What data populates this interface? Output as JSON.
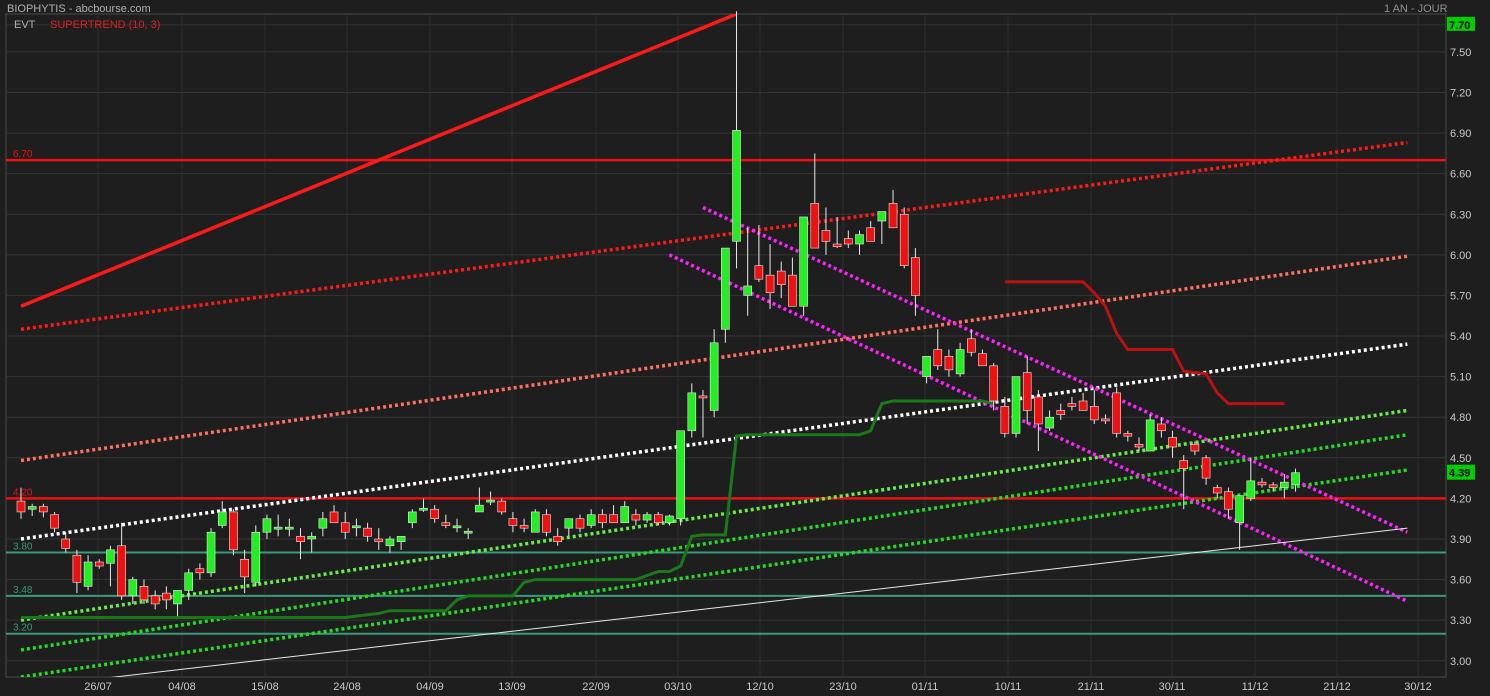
{
  "header": {
    "title": "BIOPHYTIS - abcbourse.com",
    "period": "1 AN - JOUR",
    "indicator_name": "EVT",
    "indicator_label": "SUPERTREND (10, 3)"
  },
  "chart_data": {
    "type": "candlestick",
    "ylim": [
      2.88,
      7.78
    ],
    "y_ticks": [
      "7.70",
      "7.50",
      "7.20",
      "6.90",
      "6.60",
      "6.30",
      "6.00",
      "5.70",
      "5.40",
      "5.10",
      "4.80",
      "4.50",
      "4.20",
      "3.90",
      "3.60",
      "3.30",
      "3.00"
    ],
    "x_labels": [
      "26/07",
      "04/08",
      "15/08",
      "24/08",
      "04/09",
      "13/09",
      "22/09",
      "03/10",
      "12/10",
      "23/10",
      "01/11",
      "10/11",
      "21/11",
      "30/11",
      "11/12",
      "21/12",
      "30/12"
    ],
    "last_price": "4.39",
    "horizontal_levels": [
      {
        "label": "6.70",
        "value": 6.7,
        "color": "#ee1111"
      },
      {
        "label": "4.20",
        "value": 4.2,
        "color": "#ee1111"
      },
      {
        "label": "3.80",
        "value": 3.8,
        "color": "#3a9a7a"
      },
      {
        "label": "3.48",
        "value": 3.48,
        "color": "#3a9a7a"
      },
      {
        "label": "3.20",
        "value": 3.2,
        "color": "#3a9a7a"
      }
    ],
    "candles": [
      [
        4.18,
        4.28,
        4.05,
        4.1
      ],
      [
        4.12,
        4.16,
        4.07,
        4.14
      ],
      [
        4.14,
        4.16,
        4.06,
        4.1
      ],
      [
        4.08,
        4.1,
        3.95,
        3.98
      ],
      [
        3.9,
        3.95,
        3.8,
        3.83
      ],
      [
        3.78,
        3.82,
        3.5,
        3.58
      ],
      [
        3.55,
        3.78,
        3.52,
        3.73
      ],
      [
        3.73,
        3.75,
        3.68,
        3.7
      ],
      [
        3.72,
        3.85,
        3.55,
        3.82
      ],
      [
        3.85,
        4.02,
        3.45,
        3.48
      ],
      [
        3.48,
        3.62,
        3.42,
        3.6
      ],
      [
        3.55,
        3.6,
        3.42,
        3.45
      ],
      [
        3.48,
        3.52,
        3.38,
        3.42
      ],
      [
        3.5,
        3.55,
        3.38,
        3.45
      ],
      [
        3.42,
        3.5,
        3.33,
        3.52
      ],
      [
        3.52,
        3.68,
        3.45,
        3.65
      ],
      [
        3.68,
        3.72,
        3.6,
        3.65
      ],
      [
        3.65,
        3.98,
        3.62,
        3.95
      ],
      [
        4.0,
        4.18,
        3.98,
        4.1
      ],
      [
        4.1,
        4.12,
        3.78,
        3.82
      ],
      [
        3.75,
        3.82,
        3.5,
        3.62
      ],
      [
        3.58,
        4.0,
        3.55,
        3.95
      ],
      [
        3.95,
        4.08,
        3.9,
        4.05
      ],
      [
        3.98,
        4.08,
        3.92,
        3.98
      ],
      [
        3.98,
        4.05,
        3.92,
        3.98
      ],
      [
        3.92,
        3.98,
        3.75,
        3.88
      ],
      [
        3.9,
        3.95,
        3.8,
        3.92
      ],
      [
        3.98,
        4.1,
        3.92,
        4.05
      ],
      [
        4.1,
        4.15,
        4.02,
        4.02
      ],
      [
        4.02,
        4.1,
        3.9,
        3.95
      ],
      [
        3.98,
        4.05,
        3.92,
        3.99
      ],
      [
        3.98,
        4.02,
        3.88,
        3.92
      ],
      [
        3.9,
        3.98,
        3.82,
        3.88
      ],
      [
        3.85,
        3.92,
        3.8,
        3.9
      ],
      [
        3.88,
        3.92,
        3.82,
        3.92
      ],
      [
        4.02,
        4.12,
        3.98,
        4.1
      ],
      [
        4.12,
        4.2,
        4.1,
        4.12
      ],
      [
        4.12,
        4.15,
        4.02,
        4.05
      ],
      [
        4.02,
        4.08,
        3.98,
        4.0
      ],
      [
        3.98,
        4.05,
        3.95,
        3.99
      ],
      [
        3.94,
        3.98,
        3.9,
        3.95
      ],
      [
        4.1,
        4.28,
        4.1,
        4.15
      ],
      [
        4.18,
        4.25,
        4.15,
        4.18
      ],
      [
        4.18,
        4.2,
        4.08,
        4.1
      ],
      [
        4.05,
        4.1,
        3.95,
        4.0
      ],
      [
        4.0,
        4.05,
        3.95,
        3.98
      ],
      [
        3.95,
        4.12,
        3.95,
        4.1
      ],
      [
        4.08,
        4.12,
        3.92,
        3.95
      ],
      [
        3.92,
        3.98,
        3.85,
        3.88
      ],
      [
        3.98,
        4.05,
        3.92,
        4.05
      ],
      [
        4.05,
        4.08,
        3.95,
        3.98
      ],
      [
        4.0,
        4.12,
        3.98,
        4.08
      ],
      [
        4.08,
        4.12,
        3.98,
        4.02
      ],
      [
        4.08,
        4.15,
        4.02,
        4.02
      ],
      [
        4.02,
        4.18,
        4.02,
        4.14
      ],
      [
        4.08,
        4.12,
        4.0,
        4.04
      ],
      [
        4.04,
        4.1,
        4.02,
        4.08
      ],
      [
        4.08,
        4.1,
        4.0,
        4.02
      ],
      [
        4.02,
        4.08,
        4.0,
        4.07
      ],
      [
        4.05,
        4.7,
        4.0,
        4.7
      ],
      [
        4.7,
        5.05,
        4.65,
        4.98
      ],
      [
        4.95,
        5.0,
        4.65,
        4.94
      ],
      [
        4.85,
        5.45,
        4.8,
        5.35
      ],
      [
        5.45,
        6.05,
        5.35,
        6.05
      ],
      [
        6.1,
        7.8,
        5.9,
        6.92
      ],
      [
        5.7,
        6.2,
        5.55,
        5.77
      ],
      [
        5.92,
        6.22,
        5.8,
        5.82
      ],
      [
        5.85,
        6.08,
        5.6,
        5.72
      ],
      [
        5.88,
        5.95,
        5.68,
        5.78
      ],
      [
        5.85,
        5.98,
        5.62,
        5.62
      ],
      [
        5.62,
        6.05,
        5.55,
        6.28
      ],
      [
        6.38,
        6.75,
        6.1,
        6.05
      ],
      [
        6.18,
        6.35,
        6.0,
        6.1
      ],
      [
        6.08,
        6.28,
        6.05,
        6.06
      ],
      [
        6.12,
        6.18,
        6.05,
        6.08
      ],
      [
        6.08,
        6.18,
        6.0,
        6.15
      ],
      [
        6.2,
        6.25,
        6.1,
        6.1
      ],
      [
        6.25,
        6.3,
        6.08,
        6.32
      ],
      [
        6.38,
        6.48,
        6.2,
        6.2
      ],
      [
        6.3,
        6.35,
        5.9,
        5.92
      ],
      [
        5.98,
        6.05,
        5.55,
        5.7
      ],
      [
        5.1,
        5.25,
        5.05,
        5.25
      ],
      [
        5.3,
        5.45,
        5.15,
        5.18
      ],
      [
        5.25,
        5.3,
        5.1,
        5.15
      ],
      [
        5.12,
        5.35,
        5.1,
        5.3
      ],
      [
        5.38,
        5.45,
        5.25,
        5.28
      ],
      [
        5.27,
        5.3,
        5.18,
        5.18
      ],
      [
        5.18,
        5.2,
        4.85,
        4.92
      ],
      [
        4.88,
        4.95,
        4.65,
        4.68
      ],
      [
        4.68,
        5.05,
        4.65,
        5.1
      ],
      [
        5.13,
        5.25,
        4.75,
        4.85
      ],
      [
        4.95,
        5.0,
        4.55,
        4.75
      ],
      [
        4.72,
        4.85,
        4.7,
        4.8
      ],
      [
        4.85,
        4.9,
        4.78,
        4.82
      ],
      [
        4.9,
        4.95,
        4.85,
        4.88
      ],
      [
        4.92,
        4.98,
        4.85,
        4.85
      ],
      [
        4.88,
        5.0,
        4.75,
        4.78
      ],
      [
        4.78,
        4.82,
        4.75,
        4.77
      ],
      [
        4.98,
        5.02,
        4.65,
        4.68
      ],
      [
        4.68,
        4.7,
        4.62,
        4.66
      ],
      [
        4.6,
        4.65,
        4.55,
        4.58
      ],
      [
        4.55,
        4.82,
        4.55,
        4.78
      ],
      [
        4.75,
        4.8,
        4.65,
        4.7
      ],
      [
        4.65,
        4.7,
        4.5,
        4.58
      ],
      [
        4.48,
        4.52,
        4.12,
        4.42
      ],
      [
        4.6,
        4.62,
        4.52,
        4.55
      ],
      [
        4.5,
        4.52,
        4.3,
        4.35
      ],
      [
        4.28,
        4.3,
        4.2,
        4.24
      ],
      [
        4.25,
        4.28,
        4.05,
        4.12
      ],
      [
        4.02,
        4.22,
        3.82,
        4.22
      ],
      [
        4.2,
        4.5,
        4.18,
        4.33
      ],
      [
        4.32,
        4.35,
        4.28,
        4.3
      ],
      [
        4.3,
        4.32,
        4.25,
        4.28
      ],
      [
        4.28,
        4.38,
        4.2,
        4.32
      ],
      [
        4.3,
        4.42,
        4.25,
        4.39
      ]
    ],
    "supertrend_up": [
      [
        0,
        3.32
      ],
      [
        15,
        3.32
      ],
      [
        29,
        3.32
      ],
      [
        32,
        3.35
      ],
      [
        33,
        3.37
      ],
      [
        38,
        3.37
      ],
      [
        39,
        3.45
      ],
      [
        40,
        3.48
      ],
      [
        44,
        3.48
      ],
      [
        45,
        3.58
      ],
      [
        46,
        3.6
      ],
      [
        55,
        3.6
      ],
      [
        56,
        3.63
      ],
      [
        57,
        3.66
      ],
      [
        58,
        3.66
      ],
      [
        59,
        3.7
      ],
      [
        60,
        3.92
      ],
      [
        61,
        3.93
      ],
      [
        63,
        3.93
      ],
      [
        64,
        4.66
      ],
      [
        65,
        4.67
      ],
      [
        75,
        4.67
      ],
      [
        76,
        4.7
      ],
      [
        77,
        4.9
      ],
      [
        78,
        4.92
      ],
      [
        86,
        4.92
      ],
      [
        87,
        4.9
      ]
    ],
    "supertrend_down": [
      [
        88,
        5.8
      ],
      [
        95,
        5.8
      ],
      [
        96,
        5.72
      ],
      [
        97,
        5.62
      ],
      [
        98,
        5.42
      ],
      [
        99,
        5.3
      ],
      [
        103,
        5.3
      ],
      [
        104,
        5.14
      ],
      [
        106,
        5.12
      ],
      [
        107,
        4.98
      ],
      [
        108,
        4.9
      ],
      [
        113,
        4.9
      ]
    ],
    "trendlines": [
      {
        "color": "#ff1a1a",
        "style": "solid",
        "x0": 0,
        "y0": 5.62,
        "x1": 64,
        "y1": 7.78
      },
      {
        "color": "#ff1a1a",
        "style": "dotted",
        "x0": 0,
        "y0": 5.45,
        "x1": 124,
        "y1": 6.83
      },
      {
        "color": "#ff7060",
        "style": "dotted",
        "x0": 0,
        "y0": 4.48,
        "x1": 124,
        "y1": 5.99
      },
      {
        "color": "#ffffff",
        "style": "dotted",
        "x0": 0,
        "y0": 3.9,
        "x1": 124,
        "y1": 5.34
      },
      {
        "color": "#66ee44",
        "style": "dotted",
        "x0": 0,
        "y0": 3.3,
        "x1": 124,
        "y1": 4.85
      },
      {
        "color": "#22dd22",
        "style": "dotted",
        "x0": 0,
        "y0": 3.08,
        "x1": 124,
        "y1": 4.67
      },
      {
        "color": "#22dd22",
        "style": "dotted",
        "x0": 0,
        "y0": 2.88,
        "x1": 124,
        "y1": 4.41
      },
      {
        "color": "#ff22ff",
        "style": "dotted",
        "x0": 61,
        "y0": 6.35,
        "x1": 124,
        "y1": 3.95
      },
      {
        "color": "#ff22ff",
        "style": "dotted",
        "x0": 58,
        "y0": 6.0,
        "x1": 124,
        "y1": 3.44
      },
      {
        "color": "#e8e8e8",
        "style": "thin",
        "x0": 0,
        "y0": 2.8,
        "x1": 124,
        "y1": 3.98
      }
    ]
  }
}
